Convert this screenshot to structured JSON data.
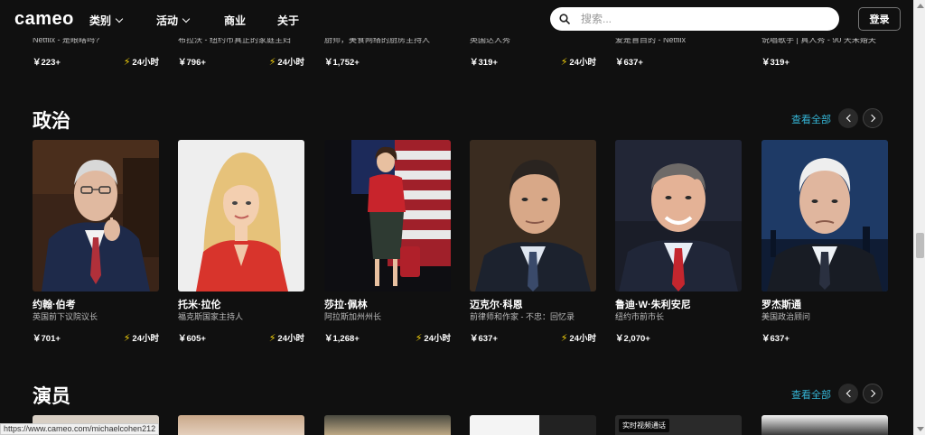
{
  "header": {
    "logo": "cameo",
    "nav": [
      "类别",
      "活动",
      "商业",
      "关于"
    ],
    "search_placeholder": "搜索...",
    "login": "登录"
  },
  "prev_row": [
    {
      "sub": "Netflix - 是眼瞎吗?",
      "price": "￥223+",
      "fast": "24小时"
    },
    {
      "sub": "布拉沃 - 纽约市真正的家庭主妇",
      "price": "￥796+",
      "fast": "24小时"
    },
    {
      "sub": "厨师，美食网络的厨房主持人",
      "price": "￥1,752+",
      "fast": ""
    },
    {
      "sub": "英国达人秀",
      "price": "￥319+",
      "fast": "24小时"
    },
    {
      "sub": "爱是盲目的 - Netflix",
      "price": "￥637+",
      "fast": ""
    },
    {
      "sub": "说唱歌手 | 真人秀 - 90 天未婚夫",
      "price": "￥319+",
      "fast": ""
    }
  ],
  "politics": {
    "title": "政治",
    "see_all": "查看全部",
    "cards": [
      {
        "name": "约翰·伯考",
        "sub": "英国前下议院议长",
        "price": "￥701+",
        "fast": "24小时"
      },
      {
        "name": "托米·拉伦",
        "sub": "福克斯国家主持人",
        "price": "￥605+",
        "fast": "24小时"
      },
      {
        "name": "莎拉·佩林",
        "sub": "阿拉斯加州州长",
        "price": "￥1,268+",
        "fast": "24小时"
      },
      {
        "name": "迈克尔·科恩",
        "sub": "前律师和作家 - 不忠：回忆录",
        "price": "￥637+",
        "fast": "24小时"
      },
      {
        "name": "鲁迪·W·朱利安尼",
        "sub": "纽约市前市长",
        "price": "￥2,070+",
        "fast": ""
      },
      {
        "name": "罗杰斯通",
        "sub": "美国政治顾问",
        "price": "￥637+",
        "fast": ""
      }
    ]
  },
  "actors": {
    "title": "演员",
    "see_all": "查看全部",
    "badge": "实时视频通话"
  },
  "status_url": "https://www.cameo.com/michaelcohen212",
  "colors": {
    "background": "#101010",
    "accent": "#35b5d6",
    "bolt": "#f5d20b"
  }
}
